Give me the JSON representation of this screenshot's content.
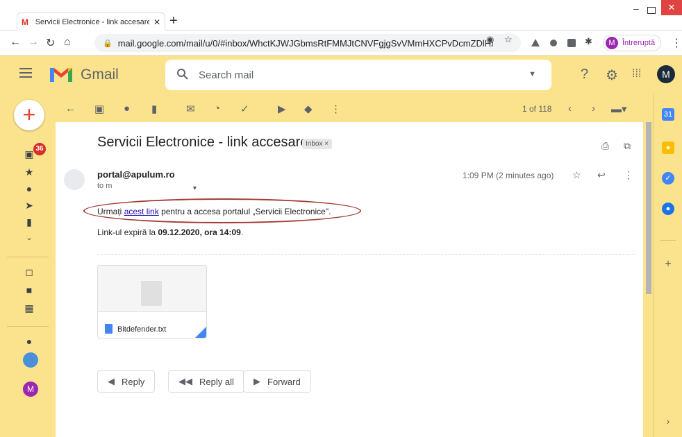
{
  "browser": {
    "tab_title": "Servicii Electronice - link accesare",
    "url": "mail.google.com/mail/u/0/#inbox/WhctKJWJGbmsRtFMMJtCNVFgjgSvVMmHXCPvDcmZDlHxC...",
    "profile_initial": "M",
    "profile_label": "Întreruptă"
  },
  "gmail": {
    "brand": "Gmail",
    "search_placeholder": "Search mail",
    "account_initial": "M",
    "inbox_badge": "36",
    "pager": "1 of 118"
  },
  "message": {
    "subject": "Servicii Electronice - link accesare",
    "label": "Inbox ×",
    "sender": "portal@apulum.ro",
    "to": "to m",
    "time": "1:09 PM (2 minutes ago)",
    "body_prefix": "Urmați",
    "body_link": "acest link",
    "body_suffix": "pentru a accesa portalul „Servicii Electronice\".",
    "expiry_prefix": "Link-ul expiră la",
    "expiry_bold": "09.12.2020, ora 14:09",
    "expiry_suffix": ".",
    "attachment_name": "Bitdefender.txt"
  },
  "actions": {
    "reply": "Reply",
    "reply_all": "Reply all",
    "forward": "Forward"
  },
  "rail_avatar_initial": "M",
  "colors": {
    "theme": "#fbe38e",
    "annotation": "#a33c33",
    "badge": "#d93025"
  }
}
